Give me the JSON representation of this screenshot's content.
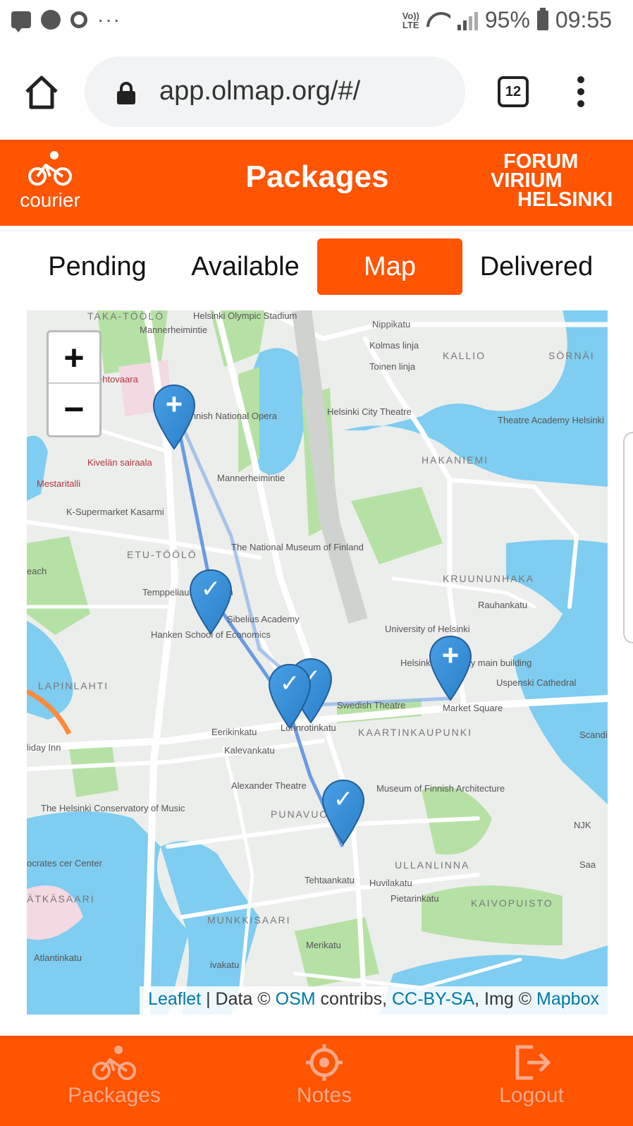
{
  "colors": {
    "brand_orange": "#ff5400",
    "nav_text_faded": "#f7a98a",
    "marker_blue": "#2a7fc8",
    "route_blue": "#3f7fe0",
    "water": "#7fcdf0",
    "park": "#b6e1a5",
    "attribution_link": "#0078a8"
  },
  "status_bar": {
    "icons": [
      "chat-icon",
      "signal-app-icon",
      "circle-icon",
      "more-dots-icon",
      "volte-icon",
      "wifi-icon",
      "cell-signal-icon",
      "battery-icon"
    ],
    "volte_top": "Vo))",
    "volte_bottom": "LTE",
    "battery": "95%",
    "time": "09:55"
  },
  "browser": {
    "url": "app.olmap.org/#/",
    "tab_count": "12"
  },
  "header": {
    "logo_label": "courier",
    "title": "Packages",
    "brand_lines": [
      "FORUM",
      "VIRIUM",
      "HELSINKI"
    ]
  },
  "tabs": [
    {
      "label": "Pending",
      "active": false
    },
    {
      "label": "Available",
      "active": false
    },
    {
      "label": "Map",
      "active": true
    },
    {
      "label": "Delivered",
      "active": false
    }
  ],
  "map": {
    "zoom_in": "+",
    "zoom_out": "−",
    "labels": [
      "TAKA-TÖÖLÖ",
      "Helsinki Olympic Stadium",
      "Mannerheimintie",
      "Nippikatu",
      "Kolmas linja",
      "Toinen linja",
      "KALLIO",
      "SÖRNÄI",
      "ehtovaara",
      "Finnish National Opera",
      "Helsinki City Theatre",
      "Theatre Academy Helsinki",
      "Kivelän sairaala",
      "HAKANIEMI",
      "Mestaritalli",
      "K-Supermarket Kasarmi",
      "Mannerheimintie",
      "ETU-TÖÖLÖ",
      "The National Museum of Finland",
      "each",
      "KRUUNUNHAKA",
      "Temppeliaukio Church",
      "Rauhankatu",
      "Sibelius Academy",
      "University of Helsinki",
      "Hanken School of Economics",
      "Helsinki University main building",
      "LAPINLAHTI",
      "Uspenski Cathedral",
      "Swedish Theatre",
      "Market Square",
      "Scandic Grand",
      "Lönnrotinkatu",
      "KAARTINKAUPUNKI",
      "Eerikinkatu",
      "Kalevankatu",
      "liday Inn",
      "Alexander Theatre",
      "Museum of Finnish Architecture",
      "The Helsinki Conservatory of Music",
      "PUNAVUORI",
      "NJK",
      "ULLANLINNA",
      "ocrates cer Center",
      "Tehtaankatu",
      "Huvilakatu",
      "Pietarinkatu",
      "ÄTKÄSAARI",
      "KAIVOPUISTO",
      "MUNKKISAARI",
      "Merikatu",
      "Atlantinkatu",
      "ivakatu",
      "Saa"
    ],
    "markers": [
      {
        "type": "pickup",
        "symbol": "+"
      },
      {
        "type": "delivered",
        "symbol": "✓"
      },
      {
        "type": "delivered",
        "symbol": "✓"
      },
      {
        "type": "delivered",
        "symbol": "✓"
      },
      {
        "type": "pickup",
        "symbol": "+"
      },
      {
        "type": "delivered",
        "symbol": "✓"
      }
    ],
    "attribution": {
      "leaflet": "Leaflet",
      "sep1": " | Data © ",
      "osm": "OSM",
      "contribs": " contribs, ",
      "license": "CC-BY-SA",
      "img": ", Img © ",
      "mapbox": "Mapbox"
    }
  },
  "bottom_nav": [
    {
      "label": "Packages",
      "icon": "bicycle-icon"
    },
    {
      "label": "Notes",
      "icon": "target-icon"
    },
    {
      "label": "Logout",
      "icon": "logout-icon"
    }
  ]
}
